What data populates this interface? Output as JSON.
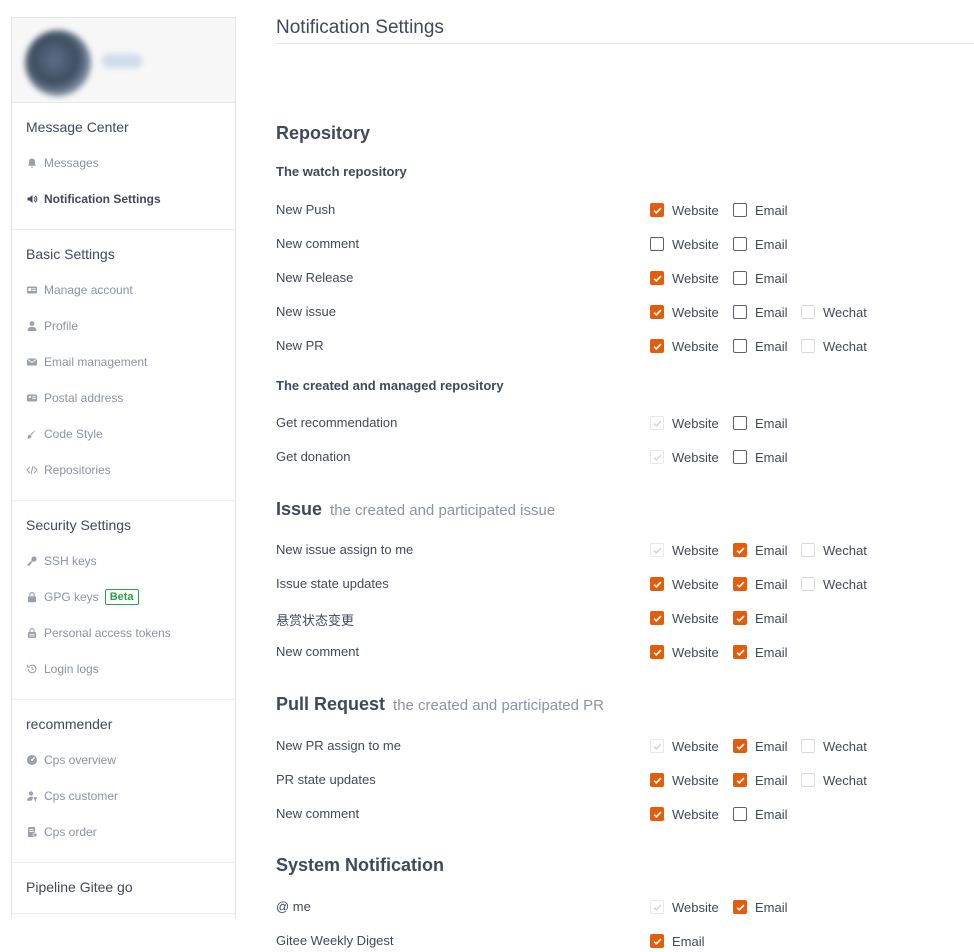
{
  "sidebar": {
    "groups": [
      {
        "title": "Message Center",
        "items": [
          {
            "label": "Messages",
            "icon": "bell-icon",
            "active": false
          },
          {
            "label": "Notification Settings",
            "icon": "speaker-icon",
            "active": true
          }
        ]
      },
      {
        "title": "Basic Settings",
        "items": [
          {
            "label": "Manage account",
            "icon": "id-card-icon"
          },
          {
            "label": "Profile",
            "icon": "user-icon"
          },
          {
            "label": "Email management",
            "icon": "envelope-icon"
          },
          {
            "label": "Postal address",
            "icon": "address-card-icon"
          },
          {
            "label": "Code Style",
            "icon": "brush-icon"
          },
          {
            "label": "Repositories",
            "icon": "code-icon"
          }
        ]
      },
      {
        "title": "Security Settings",
        "items": [
          {
            "label": "SSH keys",
            "icon": "key-icon"
          },
          {
            "label": "GPG keys",
            "icon": "lock-icon",
            "badge": "Beta"
          },
          {
            "label": "Personal access tokens",
            "icon": "token-icon"
          },
          {
            "label": "Login logs",
            "icon": "history-icon"
          }
        ]
      },
      {
        "title": "recommender",
        "items": [
          {
            "label": "Cps overview",
            "icon": "dashboard-icon"
          },
          {
            "label": "Cps customer",
            "icon": "user-key-icon"
          },
          {
            "label": "Cps order",
            "icon": "order-icon"
          }
        ]
      },
      {
        "title": "Pipeline Gitee go",
        "items": []
      }
    ]
  },
  "main": {
    "page_title": "Notification Settings",
    "sections": [
      {
        "title": "Repository",
        "subtitle": "",
        "groups": [
          {
            "subtitle": "The watch repository",
            "rows": [
              {
                "label": "New Push",
                "options": [
                  {
                    "label": "Website",
                    "state": "on"
                  },
                  {
                    "label": "Email",
                    "state": "off"
                  }
                ]
              },
              {
                "label": "New comment",
                "options": [
                  {
                    "label": "Website",
                    "state": "off"
                  },
                  {
                    "label": "Email",
                    "state": "off"
                  }
                ]
              },
              {
                "label": "New Release",
                "options": [
                  {
                    "label": "Website",
                    "state": "on"
                  },
                  {
                    "label": "Email",
                    "state": "off"
                  }
                ]
              },
              {
                "label": "New issue",
                "options": [
                  {
                    "label": "Website",
                    "state": "on"
                  },
                  {
                    "label": "Email",
                    "state": "off"
                  },
                  {
                    "label": "Wechat",
                    "state": "disabled"
                  }
                ]
              },
              {
                "label": "New PR",
                "options": [
                  {
                    "label": "Website",
                    "state": "on"
                  },
                  {
                    "label": "Email",
                    "state": "off"
                  },
                  {
                    "label": "Wechat",
                    "state": "disabled"
                  }
                ]
              }
            ]
          },
          {
            "subtitle": "The created and managed repository",
            "rows": [
              {
                "label": "Get recommendation",
                "options": [
                  {
                    "label": "Website",
                    "state": "disabled-on"
                  },
                  {
                    "label": "Email",
                    "state": "off"
                  }
                ]
              },
              {
                "label": "Get donation",
                "options": [
                  {
                    "label": "Website",
                    "state": "disabled-on"
                  },
                  {
                    "label": "Email",
                    "state": "off"
                  }
                ]
              }
            ]
          }
        ]
      },
      {
        "title": "Issue",
        "subtitle": "the created and participated issue",
        "groups": [
          {
            "subtitle": "",
            "rows": [
              {
                "label": "New issue assign to me",
                "options": [
                  {
                    "label": "Website",
                    "state": "disabled-on"
                  },
                  {
                    "label": "Email",
                    "state": "on"
                  },
                  {
                    "label": "Wechat",
                    "state": "disabled"
                  }
                ]
              },
              {
                "label": "Issue state updates",
                "options": [
                  {
                    "label": "Website",
                    "state": "on"
                  },
                  {
                    "label": "Email",
                    "state": "on"
                  },
                  {
                    "label": "Wechat",
                    "state": "disabled"
                  }
                ]
              },
              {
                "label": "悬赏状态变更",
                "options": [
                  {
                    "label": "Website",
                    "state": "on"
                  },
                  {
                    "label": "Email",
                    "state": "on"
                  }
                ]
              },
              {
                "label": "New comment",
                "options": [
                  {
                    "label": "Website",
                    "state": "on"
                  },
                  {
                    "label": "Email",
                    "state": "on"
                  }
                ]
              }
            ]
          }
        ]
      },
      {
        "title": "Pull Request",
        "subtitle": "the created and participated PR",
        "groups": [
          {
            "subtitle": "",
            "rows": [
              {
                "label": "New PR assign to me",
                "options": [
                  {
                    "label": "Website",
                    "state": "disabled-on"
                  },
                  {
                    "label": "Email",
                    "state": "on"
                  },
                  {
                    "label": "Wechat",
                    "state": "disabled"
                  }
                ]
              },
              {
                "label": "PR state updates",
                "options": [
                  {
                    "label": "Website",
                    "state": "on"
                  },
                  {
                    "label": "Email",
                    "state": "on"
                  },
                  {
                    "label": "Wechat",
                    "state": "disabled"
                  }
                ]
              },
              {
                "label": "New comment",
                "options": [
                  {
                    "label": "Website",
                    "state": "on"
                  },
                  {
                    "label": "Email",
                    "state": "off"
                  }
                ]
              }
            ]
          }
        ]
      },
      {
        "title": "System Notification",
        "subtitle": "",
        "groups": [
          {
            "subtitle": "",
            "rows": [
              {
                "label": "@ me",
                "options": [
                  {
                    "label": "Website",
                    "state": "disabled-on"
                  },
                  {
                    "label": "Email",
                    "state": "on"
                  }
                ]
              },
              {
                "label": "Gitee Weekly Digest",
                "options": [
                  {
                    "label": "Email",
                    "state": "on"
                  }
                ]
              }
            ]
          }
        ]
      }
    ]
  },
  "colors": {
    "accent": "#e55d0c",
    "text": "#40485b",
    "muted": "#8c92a4",
    "beta": "#2ba245"
  }
}
